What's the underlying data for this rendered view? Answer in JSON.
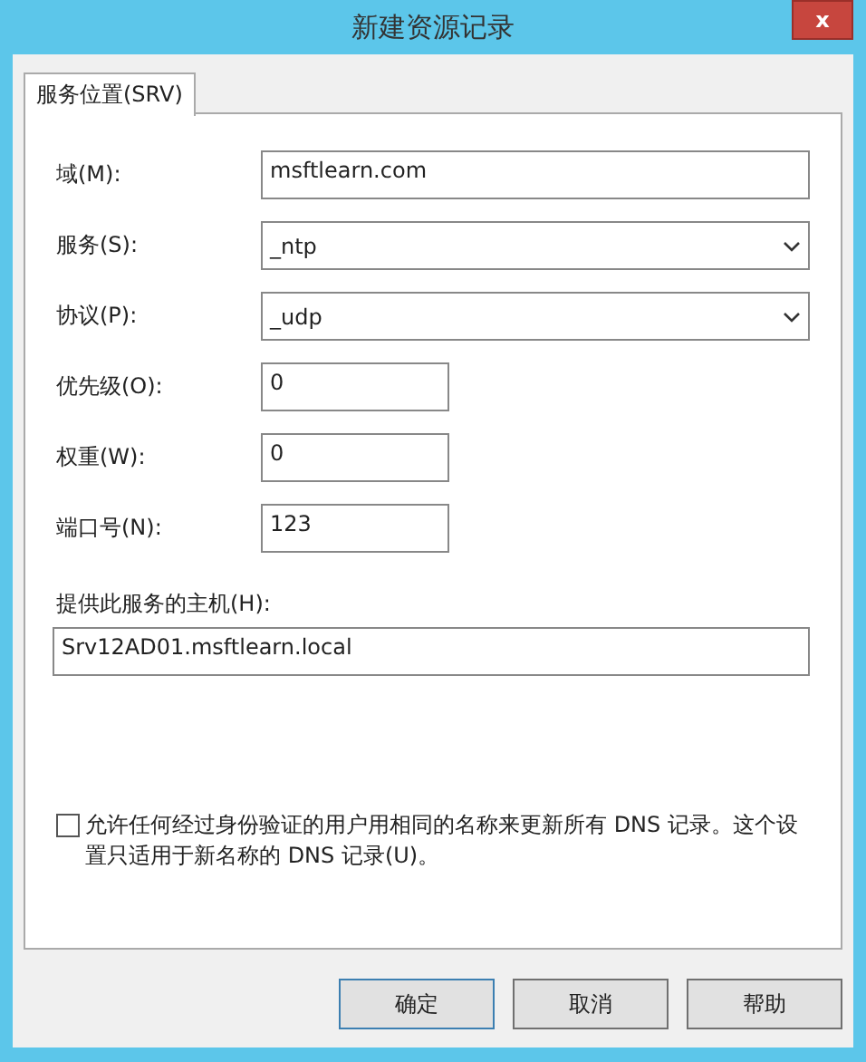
{
  "window": {
    "title": "新建资源记录",
    "close": "x"
  },
  "tabs": [
    {
      "label": "服务位置(SRV)",
      "selected": true
    }
  ],
  "fields": [
    {
      "kind": "text",
      "label": "域(M):",
      "value": "msftlearn.com"
    },
    {
      "kind": "select",
      "label": "服务(S):",
      "value": "_ntp"
    },
    {
      "kind": "select",
      "label": "协议(P):",
      "value": "_udp"
    },
    {
      "kind": "short",
      "label": "优先级(O):",
      "value": "0"
    },
    {
      "kind": "short",
      "label": "权重(W):",
      "value": "0"
    },
    {
      "kind": "short",
      "label": "端口号(N):",
      "value": "123"
    }
  ],
  "host": {
    "label": "提供此服务的主机(H):",
    "value": "Srv12AD01.msftlearn.local"
  },
  "checkbox": {
    "label": "允许任何经过身份验证的用户用相同的名称来更新所有 DNS 记录。这个设置只适用于新名称的 DNS 记录(U)。",
    "checked": false
  },
  "buttons": [
    "确定",
    "取消",
    "帮助"
  ]
}
